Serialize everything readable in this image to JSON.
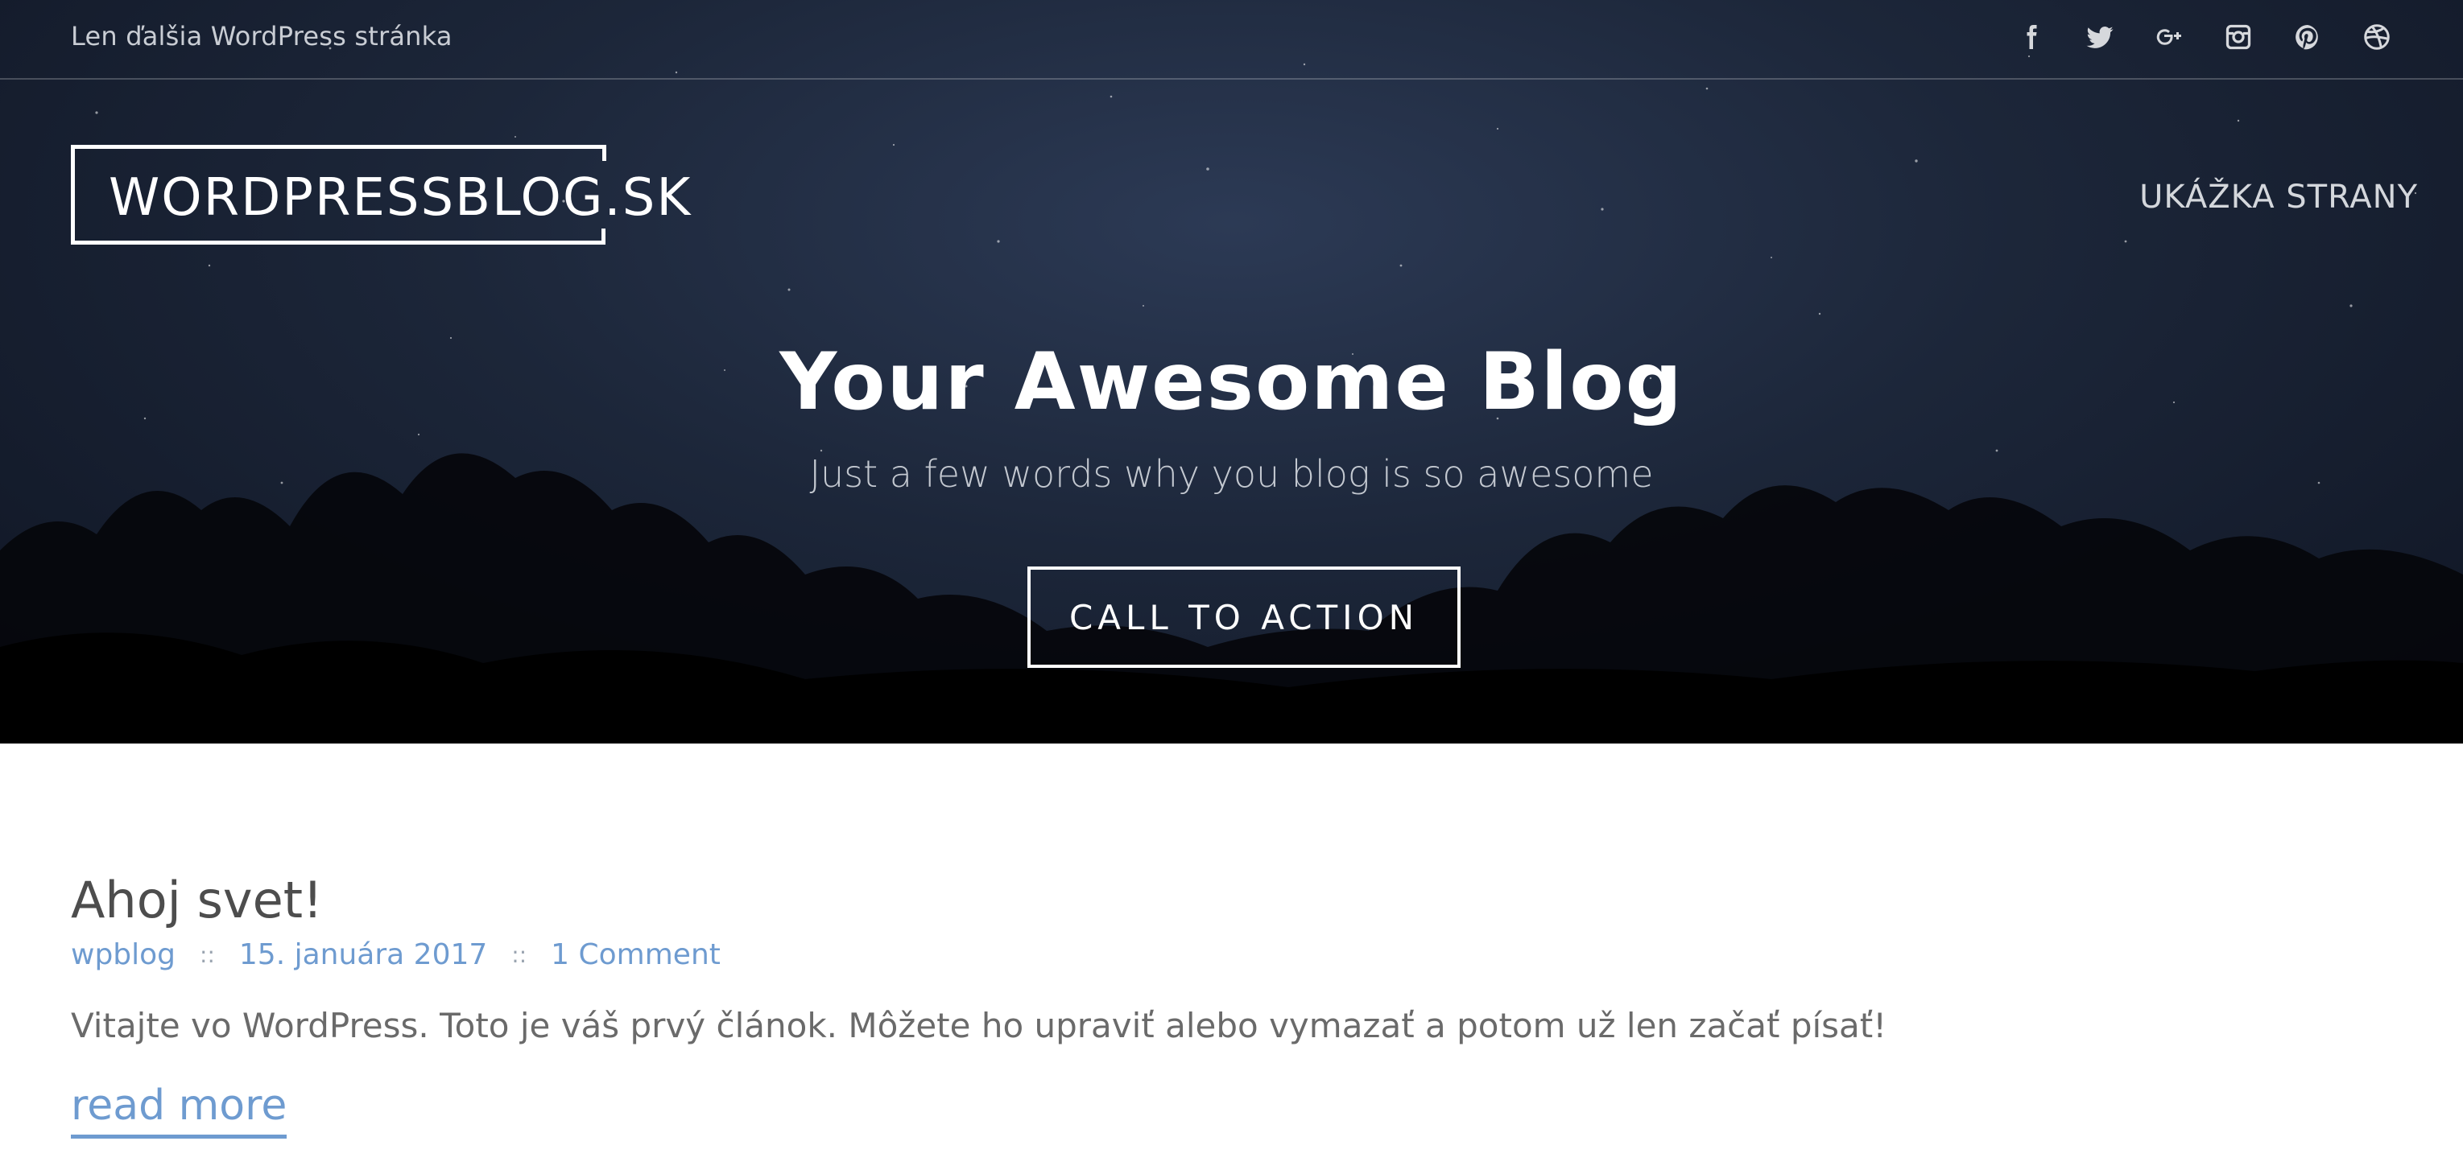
{
  "topbar": {
    "tagline": "Len ďalšia WordPress stránka",
    "social_icons": [
      "facebook-icon",
      "twitter-icon",
      "google-plus-icon",
      "instagram-icon",
      "pinterest-icon",
      "dribbble-icon"
    ]
  },
  "header": {
    "logo_text": "WORDPRESSBLOG.SK",
    "nav_items": [
      "UKÁŽKA STRANY"
    ]
  },
  "hero": {
    "title": "Your Awesome Blog",
    "subtitle": "Just a few words why you blog is so awesome",
    "cta_label": "CALL TO ACTION"
  },
  "post": {
    "title": "Ahoj svet!",
    "author": "wpblog",
    "separator": "::",
    "date": "15. januára 2017",
    "comments": "1 Comment",
    "excerpt": "Vitajte vo WordPress. Toto je váš prvý článok. Môžete ho upraviť alebo vymazať a potom už len začať písať!",
    "read_more": "read more"
  },
  "colors": {
    "link": "#6e9bd0",
    "hero_bg": "#1c2639",
    "text_dark": "#4d4d4d",
    "text_body": "#6a6a6a"
  }
}
